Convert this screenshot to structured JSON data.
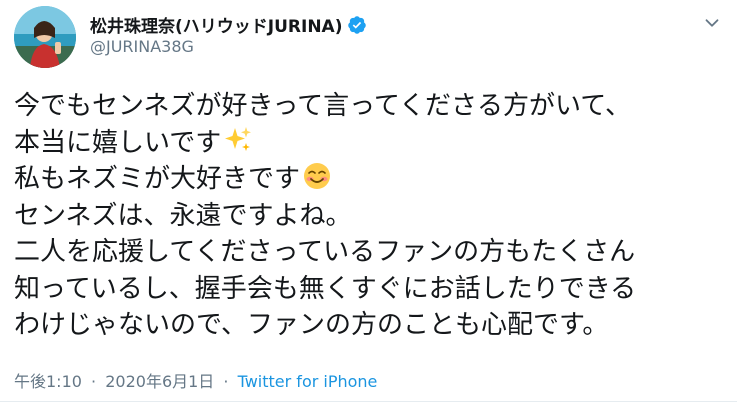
{
  "author": {
    "display_name": "松井珠理奈(ハリウッドJURINA)",
    "handle": "@JURINA38G",
    "verified": true,
    "avatar_icon": "avatar-photo"
  },
  "tweet": {
    "lines": [
      "今でもセンネズが好きって言ってくださる方がいて、",
      "本当に嬉しいです",
      "私もネズミが大好きです",
      "センネズは、永遠ですよね。",
      "二人を応援してくださっているファンの方もたくさん",
      "知っているし、握手会も無くすぐにお話したりできる",
      "わけじゃないので、ファンの方のことも心配です。"
    ],
    "emojis": {
      "line2": "sparkles-icon",
      "line3": "smiling-face-icon"
    }
  },
  "meta": {
    "time": "午後1:10",
    "separator1": "·",
    "date": "2020年6月1日",
    "separator2": "·",
    "source": "Twitter for iPhone"
  },
  "colors": {
    "text": "#14171a",
    "secondary": "#657786",
    "link": "#1b95e0",
    "verified": "#1da1f2"
  }
}
